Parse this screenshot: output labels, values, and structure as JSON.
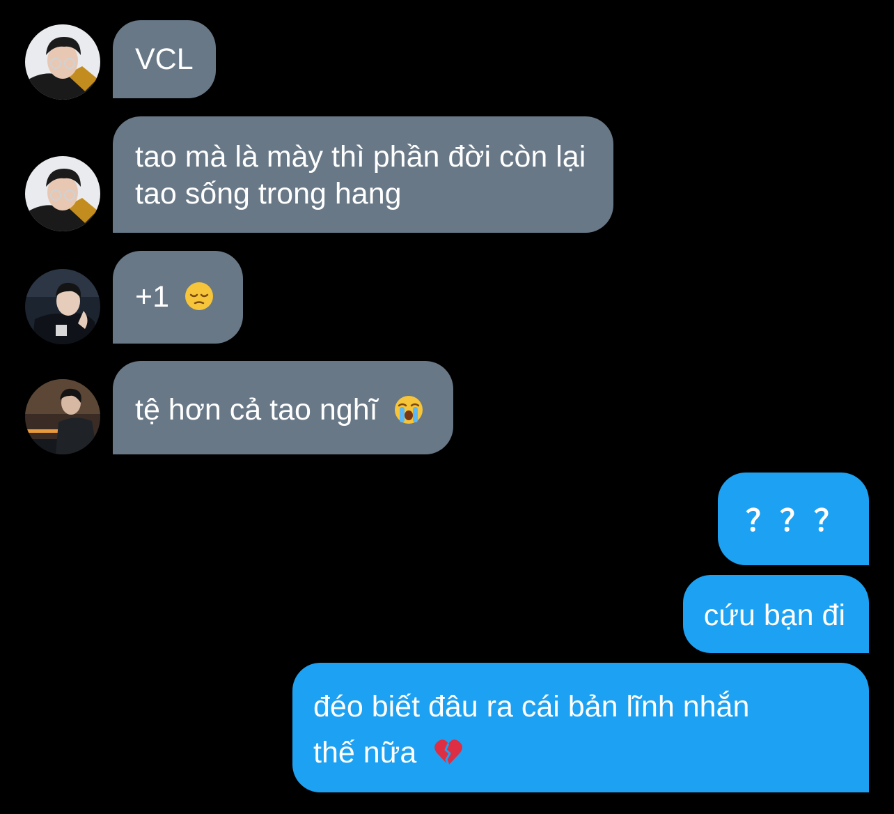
{
  "messages": [
    {
      "side": "in",
      "text": "VCL"
    },
    {
      "side": "in",
      "text": "tao mà là mày thì phần đời còn lại\ntao sống trong hang"
    },
    {
      "side": "in",
      "text": "+1",
      "emoji": "pensive-face"
    },
    {
      "side": "in",
      "text": "tệ hơn cả tao nghĩ",
      "emoji": "loudly-crying-face"
    },
    {
      "side": "out",
      "text": "？？？"
    },
    {
      "side": "out",
      "text": "cứu bạn đi"
    },
    {
      "side": "out",
      "text": "đéo biết đâu ra cái bản lĩnh nhắn\nthế nữa",
      "emoji": "broken-heart"
    }
  ],
  "colors": {
    "background": "#000000",
    "incoming_bubble": "#687887",
    "outgoing_bubble": "#1da1f2",
    "text": "#ffffff"
  }
}
